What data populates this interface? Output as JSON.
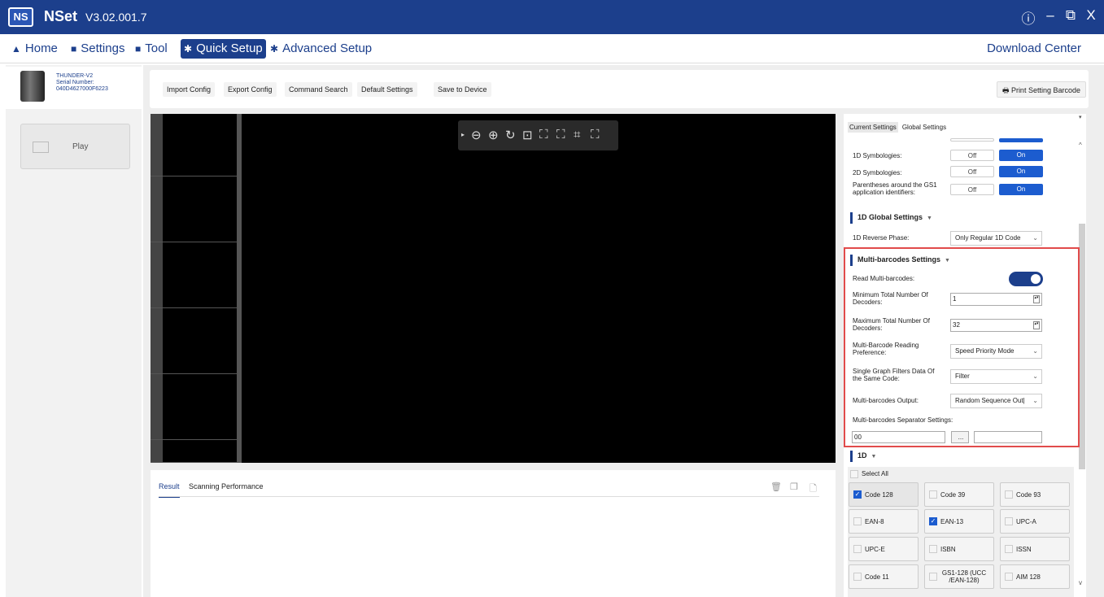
{
  "app": {
    "logo": "NS",
    "name": "NSet",
    "version": "V3.02.001.7"
  },
  "window_controls": {
    "info": "ⓘ",
    "minimize": "–",
    "restore": "⧉",
    "close": "X"
  },
  "menu": {
    "items": [
      {
        "icon": "▲",
        "label": "Home"
      },
      {
        "icon": "■",
        "label": "Settings"
      },
      {
        "icon": "■",
        "label": "Tool"
      },
      {
        "icon": "✱",
        "label": "Quick Setup"
      },
      {
        "icon": "✱",
        "label": "Advanced Setup"
      }
    ],
    "download_center": "Download Center"
  },
  "device": {
    "model": "THUNDER-V2",
    "serial_label": "Serial Number:",
    "serial": "040D4627000F6223"
  },
  "play": {
    "label": "Play"
  },
  "toolbar": {
    "buttons": [
      "Import Config",
      "Export Config",
      "Command Search",
      "Default Settings",
      "Save to Device"
    ],
    "print": "Print Setting Barcode"
  },
  "image_tools": [
    "⊖",
    "⊕",
    "↻",
    "⊡",
    "⛶",
    "⛶",
    "⌗",
    "⛶"
  ],
  "result": {
    "tabs": [
      "Result",
      "Scanning Performance"
    ]
  },
  "settings": {
    "tabs": [
      "Current Settings",
      "Global Settings"
    ],
    "symbologies": [
      {
        "label": "1D Symbologies:",
        "off": "Off",
        "on": "On"
      },
      {
        "label": "2D Symbologies:",
        "off": "Off",
        "on": "On"
      },
      {
        "label": "Parentheses around the GS1 application identifiers:",
        "off": "Off",
        "on": "On"
      }
    ],
    "global_1d": {
      "title": "1D Global Settings",
      "reverse_phase_label": "1D Reverse Phase:",
      "reverse_phase_value": "Only Regular 1D Code"
    },
    "multi": {
      "title": "Multi-barcodes Settings",
      "read_label": "Read Multi-barcodes:",
      "read_on": true,
      "min_label": "Minimum Total Number Of Decoders:",
      "min_value": "1",
      "max_label": "Maximum Total Number Of Decoders:",
      "max_value": "32",
      "pref_label": "Multi-Barcode Reading Preference:",
      "pref_value": "Speed Priority Mode",
      "filter_label": "Single Graph Filters Data Of the Same Code:",
      "filter_value": "Filter",
      "output_label": "Multi-barcodes Output:",
      "output_value": "Random Sequence Out|",
      "separator_label": "Multi-barcodes Separator Settings:",
      "separator_value": "00",
      "separator_btn": "..."
    },
    "one_d": {
      "title": "1D",
      "select_all": "Select All",
      "codes": [
        {
          "label": "Code 128",
          "checked": true
        },
        {
          "label": "Code 39",
          "checked": false
        },
        {
          "label": "Code 93",
          "checked": false
        },
        {
          "label": "EAN-8",
          "checked": false
        },
        {
          "label": "EAN-13",
          "checked": true
        },
        {
          "label": "UPC-A",
          "checked": false
        },
        {
          "label": "UPC-E",
          "checked": false
        },
        {
          "label": "ISBN",
          "checked": false
        },
        {
          "label": "ISSN",
          "checked": false
        },
        {
          "label": "Code 11",
          "checked": false
        },
        {
          "label": "GS1-128 (UCC /EAN-128)",
          "checked": false
        },
        {
          "label": "AIM 128",
          "checked": false
        }
      ]
    }
  },
  "colors": {
    "primary": "#1c3f8c",
    "toggle_on": "#1c5ccf",
    "highlight": "#e14b4b"
  }
}
